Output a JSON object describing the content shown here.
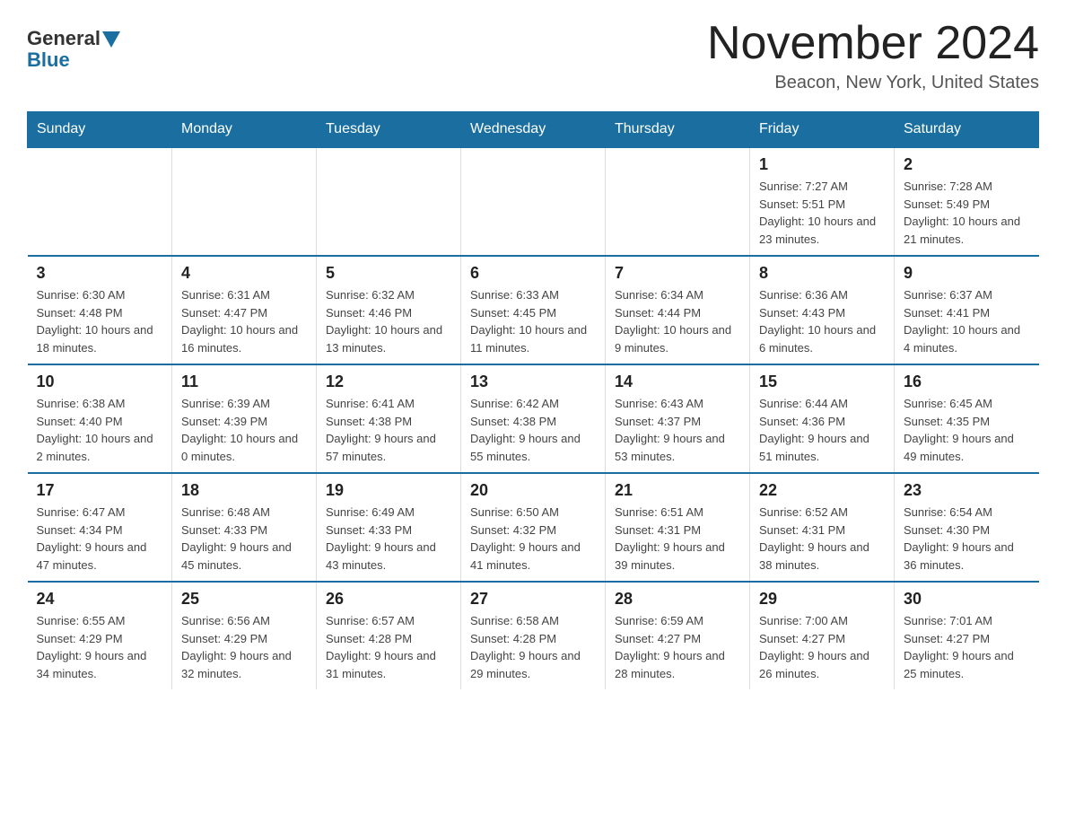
{
  "header": {
    "logo_general": "General",
    "logo_blue": "Blue",
    "title": "November 2024",
    "location": "Beacon, New York, United States"
  },
  "weekdays": [
    "Sunday",
    "Monday",
    "Tuesday",
    "Wednesday",
    "Thursday",
    "Friday",
    "Saturday"
  ],
  "weeks": [
    [
      {
        "day": "",
        "info": ""
      },
      {
        "day": "",
        "info": ""
      },
      {
        "day": "",
        "info": ""
      },
      {
        "day": "",
        "info": ""
      },
      {
        "day": "",
        "info": ""
      },
      {
        "day": "1",
        "info": "Sunrise: 7:27 AM\nSunset: 5:51 PM\nDaylight: 10 hours and 23 minutes."
      },
      {
        "day": "2",
        "info": "Sunrise: 7:28 AM\nSunset: 5:49 PM\nDaylight: 10 hours and 21 minutes."
      }
    ],
    [
      {
        "day": "3",
        "info": "Sunrise: 6:30 AM\nSunset: 4:48 PM\nDaylight: 10 hours and 18 minutes."
      },
      {
        "day": "4",
        "info": "Sunrise: 6:31 AM\nSunset: 4:47 PM\nDaylight: 10 hours and 16 minutes."
      },
      {
        "day": "5",
        "info": "Sunrise: 6:32 AM\nSunset: 4:46 PM\nDaylight: 10 hours and 13 minutes."
      },
      {
        "day": "6",
        "info": "Sunrise: 6:33 AM\nSunset: 4:45 PM\nDaylight: 10 hours and 11 minutes."
      },
      {
        "day": "7",
        "info": "Sunrise: 6:34 AM\nSunset: 4:44 PM\nDaylight: 10 hours and 9 minutes."
      },
      {
        "day": "8",
        "info": "Sunrise: 6:36 AM\nSunset: 4:43 PM\nDaylight: 10 hours and 6 minutes."
      },
      {
        "day": "9",
        "info": "Sunrise: 6:37 AM\nSunset: 4:41 PM\nDaylight: 10 hours and 4 minutes."
      }
    ],
    [
      {
        "day": "10",
        "info": "Sunrise: 6:38 AM\nSunset: 4:40 PM\nDaylight: 10 hours and 2 minutes."
      },
      {
        "day": "11",
        "info": "Sunrise: 6:39 AM\nSunset: 4:39 PM\nDaylight: 10 hours and 0 minutes."
      },
      {
        "day": "12",
        "info": "Sunrise: 6:41 AM\nSunset: 4:38 PM\nDaylight: 9 hours and 57 minutes."
      },
      {
        "day": "13",
        "info": "Sunrise: 6:42 AM\nSunset: 4:38 PM\nDaylight: 9 hours and 55 minutes."
      },
      {
        "day": "14",
        "info": "Sunrise: 6:43 AM\nSunset: 4:37 PM\nDaylight: 9 hours and 53 minutes."
      },
      {
        "day": "15",
        "info": "Sunrise: 6:44 AM\nSunset: 4:36 PM\nDaylight: 9 hours and 51 minutes."
      },
      {
        "day": "16",
        "info": "Sunrise: 6:45 AM\nSunset: 4:35 PM\nDaylight: 9 hours and 49 minutes."
      }
    ],
    [
      {
        "day": "17",
        "info": "Sunrise: 6:47 AM\nSunset: 4:34 PM\nDaylight: 9 hours and 47 minutes."
      },
      {
        "day": "18",
        "info": "Sunrise: 6:48 AM\nSunset: 4:33 PM\nDaylight: 9 hours and 45 minutes."
      },
      {
        "day": "19",
        "info": "Sunrise: 6:49 AM\nSunset: 4:33 PM\nDaylight: 9 hours and 43 minutes."
      },
      {
        "day": "20",
        "info": "Sunrise: 6:50 AM\nSunset: 4:32 PM\nDaylight: 9 hours and 41 minutes."
      },
      {
        "day": "21",
        "info": "Sunrise: 6:51 AM\nSunset: 4:31 PM\nDaylight: 9 hours and 39 minutes."
      },
      {
        "day": "22",
        "info": "Sunrise: 6:52 AM\nSunset: 4:31 PM\nDaylight: 9 hours and 38 minutes."
      },
      {
        "day": "23",
        "info": "Sunrise: 6:54 AM\nSunset: 4:30 PM\nDaylight: 9 hours and 36 minutes."
      }
    ],
    [
      {
        "day": "24",
        "info": "Sunrise: 6:55 AM\nSunset: 4:29 PM\nDaylight: 9 hours and 34 minutes."
      },
      {
        "day": "25",
        "info": "Sunrise: 6:56 AM\nSunset: 4:29 PM\nDaylight: 9 hours and 32 minutes."
      },
      {
        "day": "26",
        "info": "Sunrise: 6:57 AM\nSunset: 4:28 PM\nDaylight: 9 hours and 31 minutes."
      },
      {
        "day": "27",
        "info": "Sunrise: 6:58 AM\nSunset: 4:28 PM\nDaylight: 9 hours and 29 minutes."
      },
      {
        "day": "28",
        "info": "Sunrise: 6:59 AM\nSunset: 4:27 PM\nDaylight: 9 hours and 28 minutes."
      },
      {
        "day": "29",
        "info": "Sunrise: 7:00 AM\nSunset: 4:27 PM\nDaylight: 9 hours and 26 minutes."
      },
      {
        "day": "30",
        "info": "Sunrise: 7:01 AM\nSunset: 4:27 PM\nDaylight: 9 hours and 25 minutes."
      }
    ]
  ]
}
